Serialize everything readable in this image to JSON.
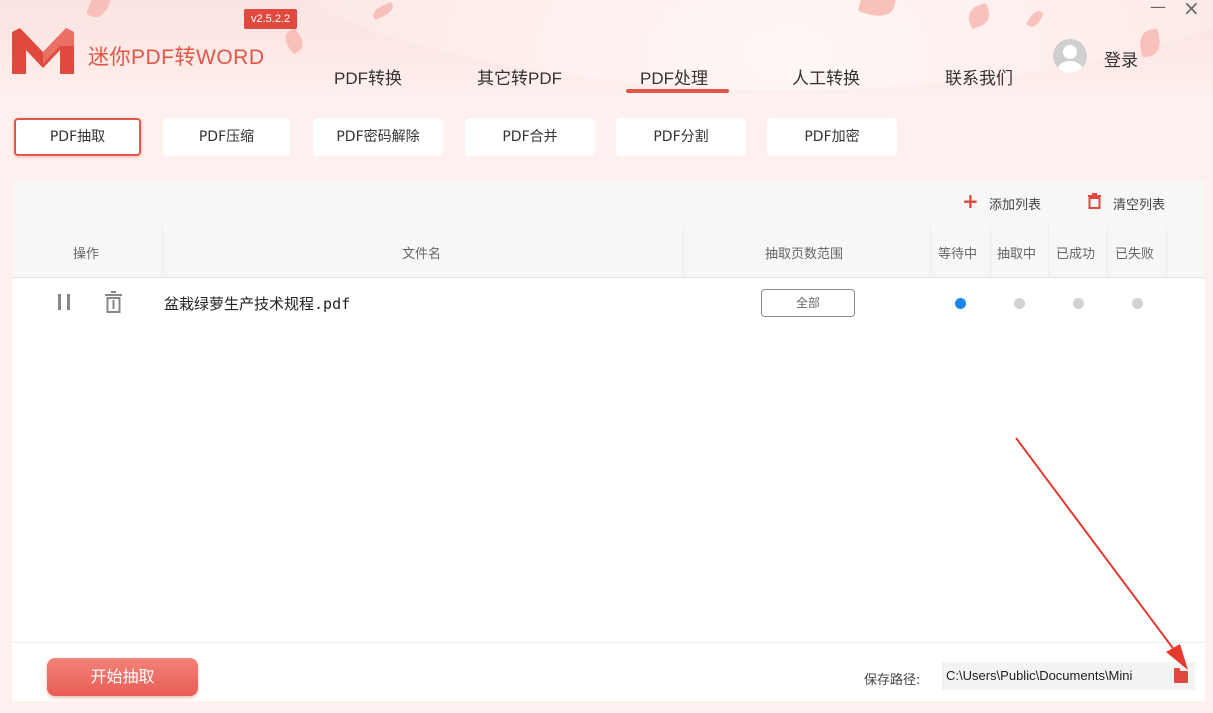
{
  "app": {
    "title": "迷你PDF转WORD",
    "version": "v2.5.2.2",
    "login_label": "登录",
    "accent_color": "#e0564a"
  },
  "nav": {
    "items": [
      {
        "label": "PDF转换"
      },
      {
        "label": "其它转PDF"
      },
      {
        "label": "PDF处理"
      },
      {
        "label": "人工转换"
      },
      {
        "label": "联系我们"
      }
    ],
    "active": "PDF处理"
  },
  "subtabs": {
    "items": [
      {
        "label": "PDF抽取"
      },
      {
        "label": "PDF压缩"
      },
      {
        "label": "PDF密码解除"
      },
      {
        "label": "PDF合并"
      },
      {
        "label": "PDF分割"
      },
      {
        "label": "PDF加密"
      }
    ],
    "active": "PDF抽取"
  },
  "toolbar": {
    "add_label": "添加列表",
    "clear_label": "清空列表"
  },
  "table": {
    "columns": {
      "op": "操作",
      "filename": "文件名",
      "range": "抽取页数范围",
      "waiting": "等待中",
      "extracting": "抽取中",
      "success": "已成功",
      "failed": "已失败"
    },
    "rows": [
      {
        "filename": "盆栽绿萝生产技术规程.pdf",
        "range": "全部",
        "status": "waiting"
      }
    ]
  },
  "footer": {
    "start_label": "开始抽取",
    "save_label": "保存路径:",
    "save_path": "C:\\Users\\Public\\Documents\\Mini"
  },
  "icons": {
    "status_active_color": "#1a86e8",
    "status_inactive_color": "#d2d2d2"
  }
}
